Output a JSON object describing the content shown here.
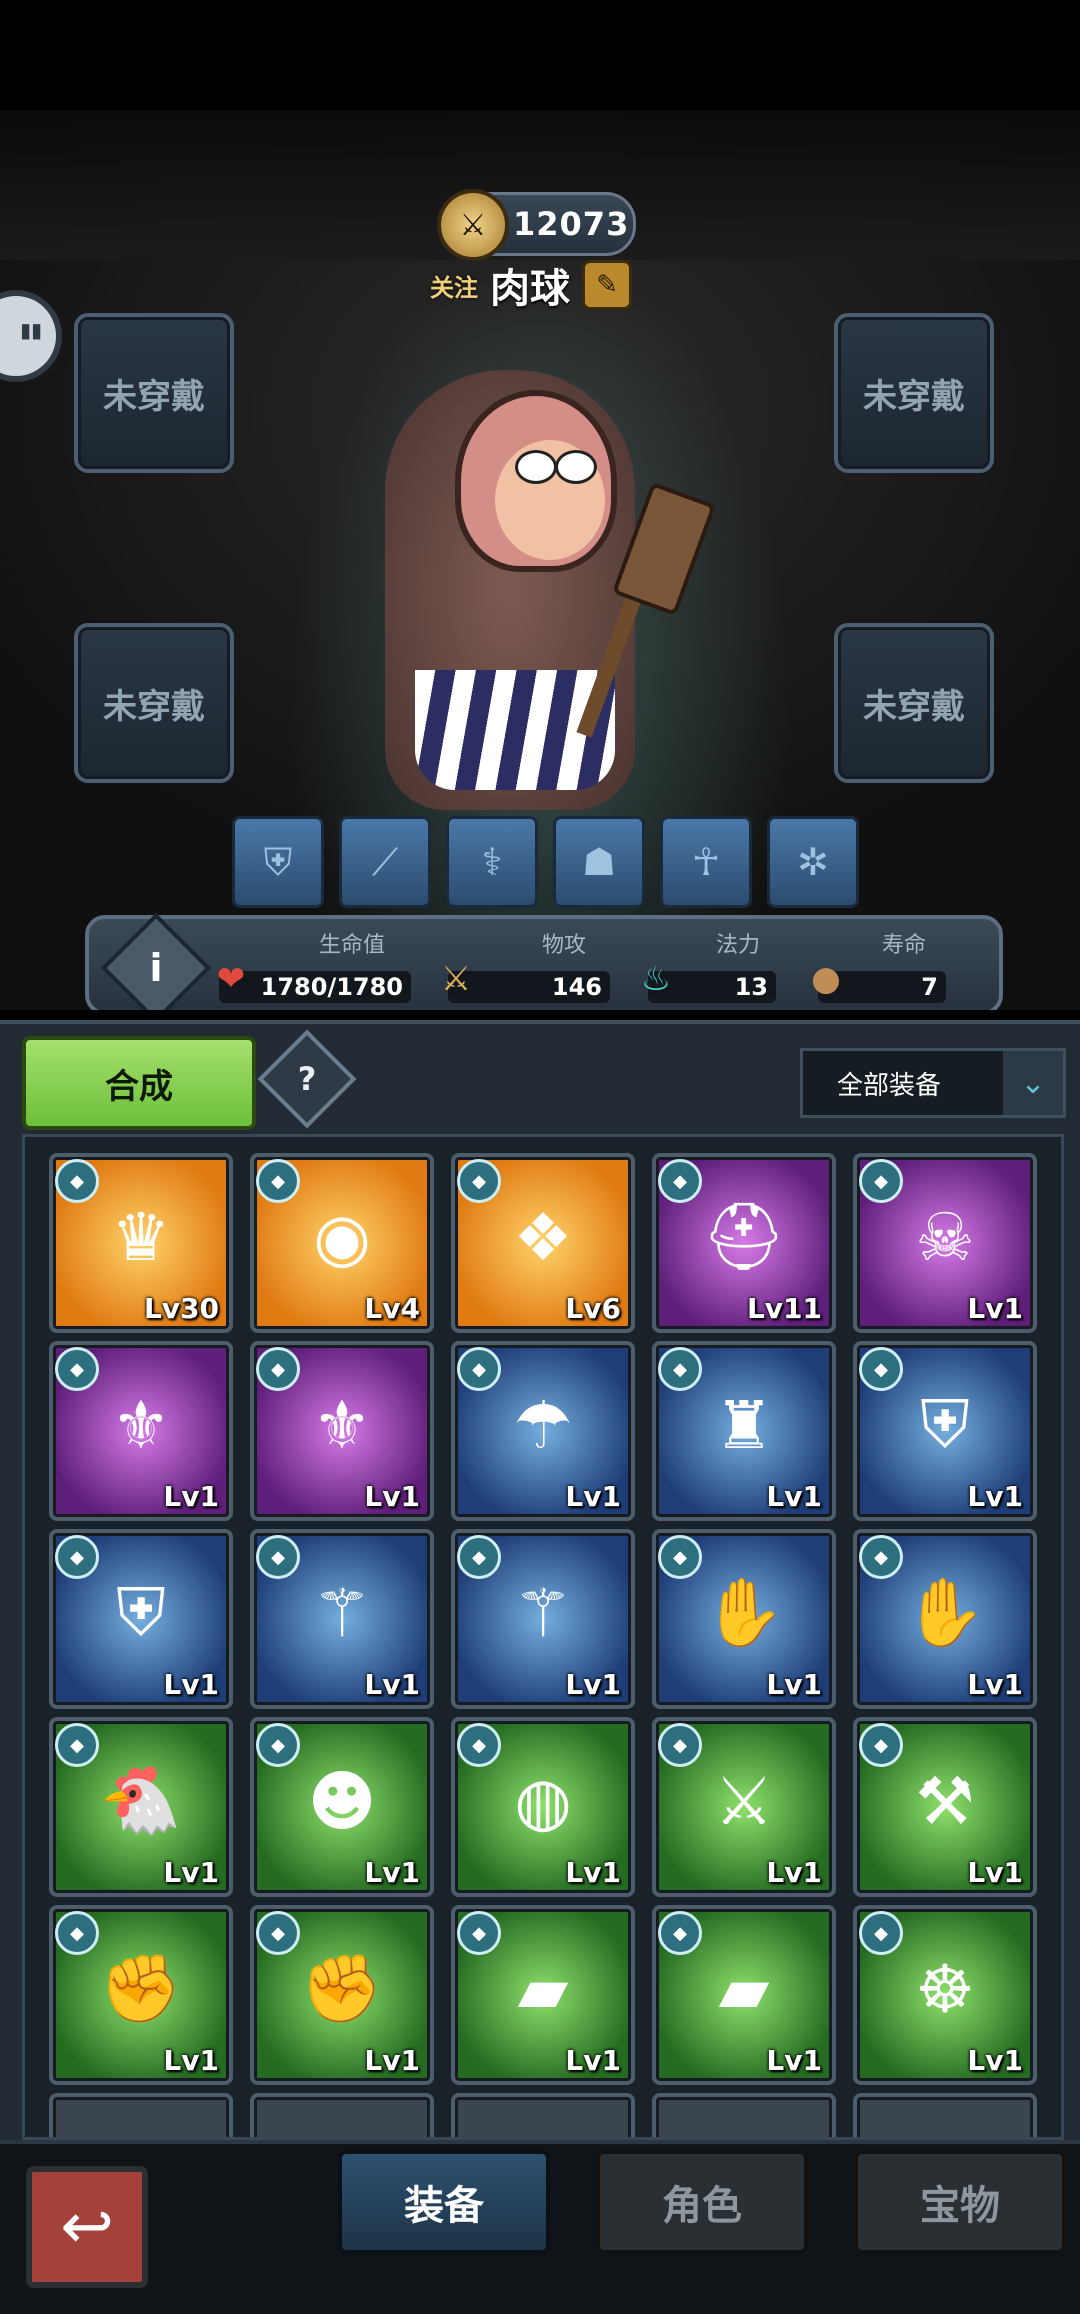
{
  "header": {
    "combat_power": "12073",
    "follow_label": "关注",
    "hero_name": "肉球"
  },
  "slots": {
    "top_left": "未穿戴",
    "top_right": "未穿戴",
    "bottom_left": "未穿戴",
    "bottom_right": "未穿戴"
  },
  "skills": [
    "shield-skill-icon",
    "bone-skill-icon",
    "caduceus-skill-icon",
    "muscle-skill-icon",
    "hug-skill-icon",
    "swirl-skill-icon"
  ],
  "stats": {
    "hp_label": "生命值",
    "hp_value": "1780/1780",
    "attack_label": "物攻",
    "attack_value": "146",
    "magic_label": "法力",
    "magic_value": "13",
    "life_label": "寿命",
    "life_value": "7"
  },
  "inventory": {
    "synth_label": "合成",
    "help_label": "?",
    "filter_label": "全部装备",
    "items": [
      {
        "name": "crown",
        "rarity": "orange",
        "level": "Lv30",
        "glyph": "♛"
      },
      {
        "name": "lion-ring",
        "rarity": "orange",
        "level": "Lv4",
        "glyph": "◉"
      },
      {
        "name": "necklace",
        "rarity": "orange",
        "level": "Lv6",
        "glyph": "❖"
      },
      {
        "name": "knight-helmet",
        "rarity": "purple",
        "level": "Lv11",
        "glyph": "⛑"
      },
      {
        "name": "cursed-mask",
        "rarity": "purple",
        "level": "Lv1",
        "glyph": "☠"
      },
      {
        "name": "winged-armor",
        "rarity": "purple",
        "level": "Lv1",
        "glyph": "⚜"
      },
      {
        "name": "winged-armor",
        "rarity": "purple",
        "level": "Lv1",
        "glyph": "⚜"
      },
      {
        "name": "blue-cape",
        "rarity": "blue",
        "level": "Lv1",
        "glyph": "☂"
      },
      {
        "name": "black-suit",
        "rarity": "blue",
        "level": "Lv1",
        "glyph": "♜"
      },
      {
        "name": "golden-shield",
        "rarity": "blue",
        "level": "Lv1",
        "glyph": "⛨"
      },
      {
        "name": "golden-shield",
        "rarity": "blue",
        "level": "Lv1",
        "glyph": "⛨"
      },
      {
        "name": "bindle-staff",
        "rarity": "blue",
        "level": "Lv1",
        "glyph": "⚚"
      },
      {
        "name": "bindle-staff",
        "rarity": "blue",
        "level": "Lv1",
        "glyph": "⚚"
      },
      {
        "name": "white-gloves",
        "rarity": "blue",
        "level": "Lv1",
        "glyph": "✋"
      },
      {
        "name": "white-gloves",
        "rarity": "blue",
        "level": "Lv1",
        "glyph": "✋"
      },
      {
        "name": "chicken-hat",
        "rarity": "green",
        "level": "Lv1",
        "glyph": "🐔"
      },
      {
        "name": "skull-mask",
        "rarity": "green",
        "level": "Lv1",
        "glyph": "☻"
      },
      {
        "name": "sack-armor",
        "rarity": "green",
        "level": "Lv1",
        "glyph": "◍"
      },
      {
        "name": "steel-sword",
        "rarity": "green",
        "level": "Lv1",
        "glyph": "⚔"
      },
      {
        "name": "wooden-staff",
        "rarity": "green",
        "level": "Lv1",
        "glyph": "⚒"
      },
      {
        "name": "red-gloves",
        "rarity": "green",
        "level": "Lv1",
        "glyph": "✊"
      },
      {
        "name": "red-gloves",
        "rarity": "green",
        "level": "Lv1",
        "glyph": "✊"
      },
      {
        "name": "wooden-clogs",
        "rarity": "green",
        "level": "Lv1",
        "glyph": "▰"
      },
      {
        "name": "wooden-clogs",
        "rarity": "green",
        "level": "Lv1",
        "glyph": "▰"
      },
      {
        "name": "chain-wheel",
        "rarity": "green",
        "level": "Lv1",
        "glyph": "☸"
      }
    ]
  },
  "nav": {
    "back_label": "↩",
    "tab_equipment": "装备",
    "tab_character": "角色",
    "tab_treasure": "宝物"
  }
}
